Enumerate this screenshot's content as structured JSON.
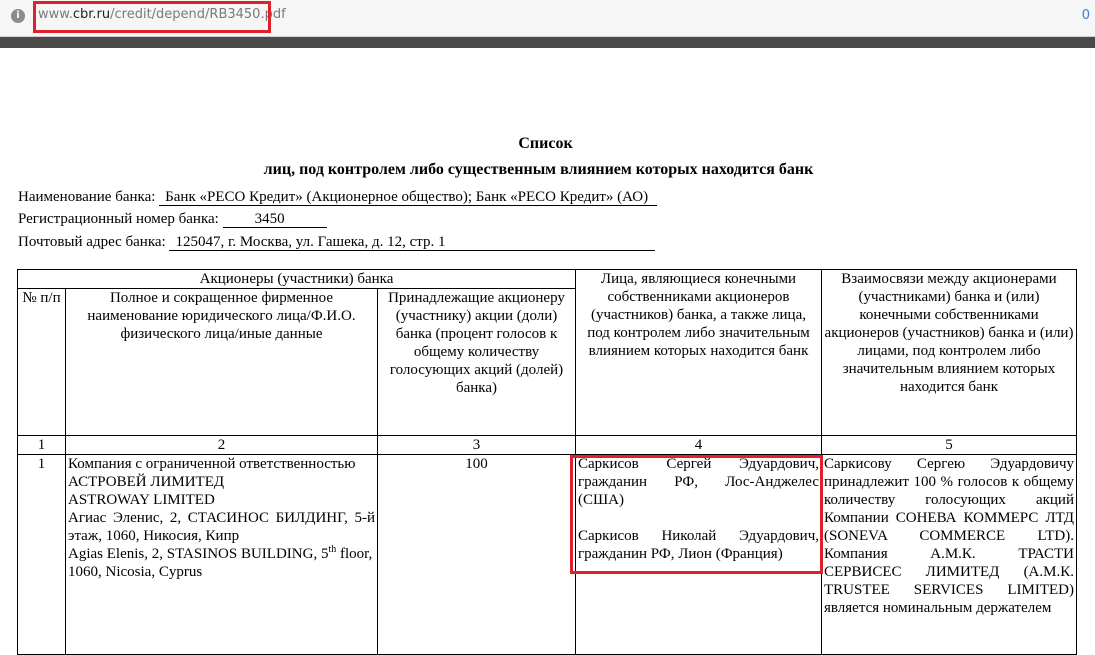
{
  "browser": {
    "url_prefix": "www.",
    "url_domain": "cbr.ru",
    "url_path": "/credit/depend/RB3450.pdf",
    "right_indicator": "0"
  },
  "document": {
    "title": "Список",
    "subtitle": "лиц, под контролем либо существенным влиянием которых находится банк",
    "bank_name_label": "Наименование банка:",
    "bank_name_value": "Банк «РЕСО Кредит» (Акционерное общество); Банк «РЕСО Кредит» (АО)",
    "reg_number_label": "Регистрационный номер банка:",
    "reg_number_value": "3450",
    "address_label": "Почтовый адрес банка:",
    "address_value": "125047, г. Москва, ул. Гашека, д. 12, стр. 1"
  },
  "table": {
    "group_header": "Акционеры (участники) банка",
    "headers": {
      "num": "№ п/п",
      "name": "Полное и сокращенное фирменное наименование юридического лица/Ф.И.О. физического лица/иные данные",
      "shares": "Принадлежащие акционеру (участнику) акции (доли) банка (процент голосов к общему количеству голосующих акций (долей) банка)",
      "owners": "Лица, являющиеся конечными собственниками акционеров (участников) банка, а также лица, под контролем либо значительным влиянием которых находится банк",
      "relations": "Взаимосвязи между акционерами (участниками) банка и (или) конечными собственниками акционеров (участников) банка и (или) лицами, под контролем либо значительным влиянием которых находится банк"
    },
    "column_numbers": [
      "1",
      "2",
      "3",
      "4",
      "5"
    ],
    "rows": [
      {
        "num": "1",
        "name_lines": [
          "Компания с ограниченной ответственностью",
          "АСТРОВЕЙ ЛИМИТЕД",
          "ASTROWAY LIMITED",
          "Агиас Эленис, 2, СТАСИНОС БИЛДИНГ, 5-й этаж, 1060, Никосия, Кипр"
        ],
        "address_en_part1": "Agias Elenis, 2, STASINOS BUILDING, 5",
        "address_en_sup": "th",
        "address_en_part2": "floor, 1060, Nicosia, Cyprus",
        "shares": "100",
        "owner1": "Саркисов Сергей Эдуардович, гражданин РФ, Лос-Анджелес (США)",
        "owner2": "Саркисов Николай Эдуардович, гражданин РФ, Лион (Франция)",
        "relations": "Саркисову Сергею Эдуардовичу принадлежит 100 % голосов к общему количеству голосующих акций Компании СОНЕВА КОММЕРС ЛТД (SONEVA COMMERCE LTD). Компания А.М.К. ТРАСТИ СЕРВИСЕС ЛИМИТЕД (А.М.К. TRUSTEE SERVICES LIMITED) является номинальным держателем"
      }
    ]
  },
  "colors": {
    "highlight": "#e0202a"
  }
}
